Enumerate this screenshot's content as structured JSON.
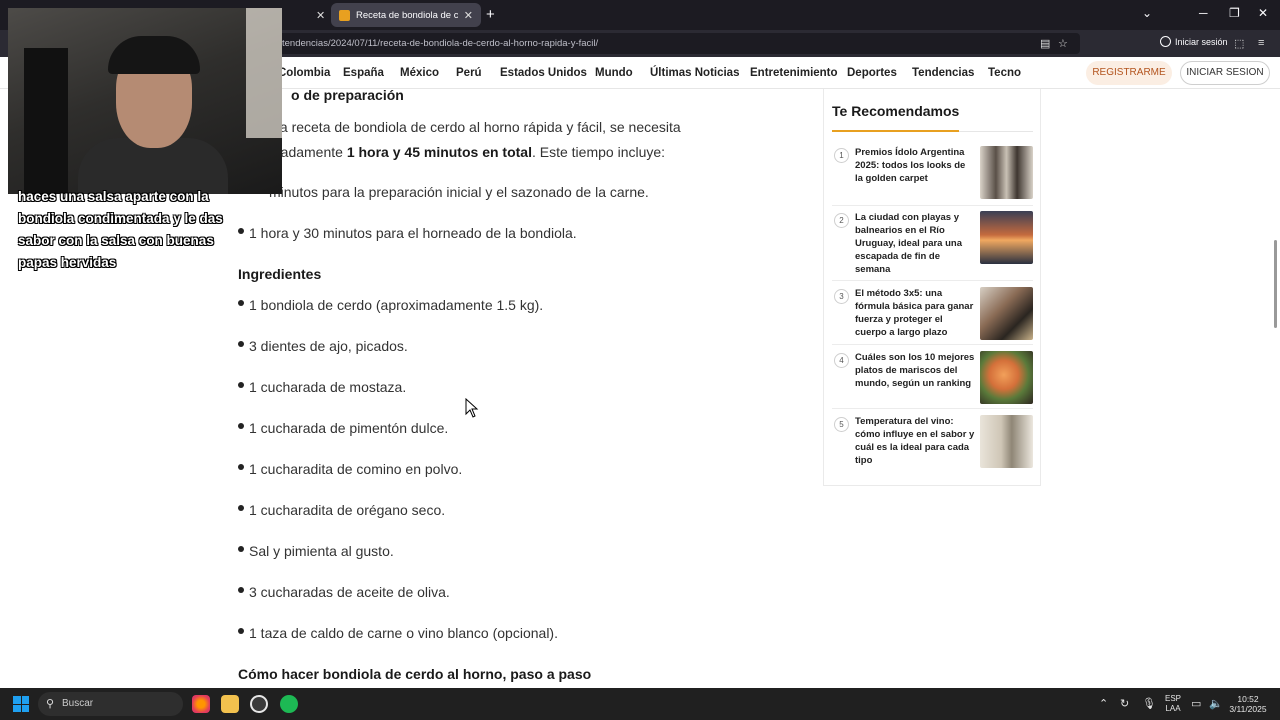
{
  "browser": {
    "tabs": [
      {
        "label": "",
        "active": false
      },
      {
        "label": "Receta de bondiola de cerdo al horno",
        "active": true
      }
    ],
    "url": "tendencias/2024/07/11/receta-de-bondiola-de-cerdo-al-horno-rapida-y-facil/",
    "signin_label": "Iniciar sesión"
  },
  "nav": {
    "items": [
      "Colombia",
      "España",
      "México",
      "Perú",
      "Estados Unidos",
      "Mundo",
      "Últimas Noticias",
      "Entretenimiento",
      "Deportes",
      "Tendencias",
      "Tecno"
    ],
    "register_label": "REGISTRARME",
    "login_label": "INICIAR SESION"
  },
  "article": {
    "section_heading": "o de preparación",
    "intro_line1": "sta receta de bondiola de cerdo al horno rápida y fácil, se necesita",
    "intro_line2_pre": "madamente ",
    "intro_line2_bold": "1 hora y 45 minutos en total",
    "intro_line2_post": ". Este tiempo incluye:",
    "time_items": [
      "minutos para la preparación inicial y el sazonado de la carne.",
      "1 hora y 30 minutos para el horneado de la bondiola."
    ],
    "ingredients_heading": "Ingredientes",
    "ingredients": [
      "1 bondiola de cerdo (aproximadamente 1.5 kg).",
      "3 dientes de ajo, picados.",
      "1 cucharada de mostaza.",
      "1 cucharada de pimentón dulce.",
      "1 cucharadita de comino en polvo.",
      "1 cucharadita de orégano seco.",
      "Sal y pimienta al gusto.",
      "3 cucharadas de aceite de oliva.",
      "1 taza de caldo de carne o vino blanco (opcional)."
    ],
    "steps_heading": "Cómo hacer bondiola de cerdo al horno, paso a paso"
  },
  "sidebar": {
    "title": "Te Recomendamos",
    "items": [
      {
        "num": "1",
        "text": "Premios Ídolo Argentina 2025: todos los looks de la golden carpet",
        "thumb_color": "#8a7e74"
      },
      {
        "num": "2",
        "text": "La ciudad con playas y balnearios en el Río Uruguay, ideal para una escapada de fin de semana",
        "thumb_color": "#c46a3e"
      },
      {
        "num": "3",
        "text": "El método 3x5: una fórmula básica para ganar fuerza y proteger el cuerpo a largo plazo",
        "thumb_color": "#6d5a48"
      },
      {
        "num": "4",
        "text": "Cuáles son los 10 mejores platos de mariscos del mundo, según un ranking",
        "thumb_color": "#b8743a"
      },
      {
        "num": "5",
        "text": "Temperatura del vino: cómo influye en el sabor y cuál es la ideal para cada tipo",
        "thumb_color": "#cfc6b6"
      }
    ]
  },
  "overlay": {
    "caption": "haces una salsa aparte con la bondiola condimentada y le das sabor con la salsa con buenas papas hervidas"
  },
  "taskbar": {
    "search_placeholder": "Buscar",
    "lang_top": "ESP",
    "lang_bottom": "LAA",
    "time": "10:52",
    "date": "3/11/2025"
  }
}
